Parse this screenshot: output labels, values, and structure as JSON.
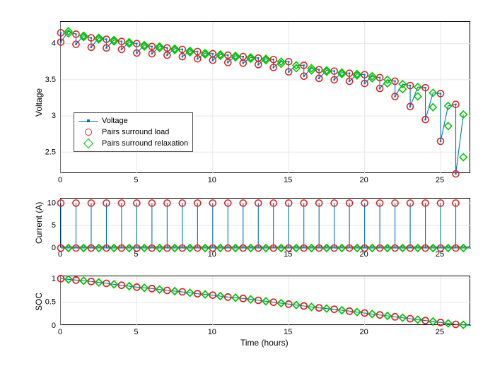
{
  "chart_data": [
    {
      "type": "line",
      "title": "",
      "xlabel": "",
      "ylabel": "Voltage",
      "xlim": [
        0,
        27
      ],
      "ylim": [
        2.2,
        4.3
      ],
      "xticks": [
        0,
        5,
        10,
        15,
        20,
        25
      ],
      "yticks": [
        2.5,
        3,
        3.5,
        4
      ],
      "legend": {
        "entries": [
          "Voltage",
          "Pairs surround load",
          "Pairs surround relaxation"
        ],
        "position": "lower-left-inset"
      },
      "series_voltage_pairs": [
        [
          0,
          4.15,
          4.02
        ],
        [
          1,
          4.13,
          3.99
        ],
        [
          2,
          4.08,
          3.95
        ],
        [
          3,
          4.06,
          3.94
        ],
        [
          4,
          4.03,
          3.92
        ],
        [
          5,
          4.0,
          3.87
        ],
        [
          6,
          3.96,
          3.86
        ],
        [
          7,
          3.94,
          3.84
        ],
        [
          8,
          3.92,
          3.82
        ],
        [
          9,
          3.89,
          3.79
        ],
        [
          10,
          3.86,
          3.77
        ],
        [
          11,
          3.84,
          3.74
        ],
        [
          12,
          3.82,
          3.73
        ],
        [
          13,
          3.8,
          3.71
        ],
        [
          14,
          3.78,
          3.67
        ],
        [
          15,
          3.75,
          3.61
        ],
        [
          16,
          3.7,
          3.55
        ],
        [
          17,
          3.64,
          3.52
        ],
        [
          18,
          3.62,
          3.5
        ],
        [
          19,
          3.59,
          3.48
        ],
        [
          20,
          3.57,
          3.45
        ],
        [
          21,
          3.53,
          3.38
        ],
        [
          22,
          3.48,
          3.27
        ],
        [
          23,
          3.42,
          3.13
        ],
        [
          24,
          3.39,
          2.95
        ],
        [
          25,
          3.31,
          2.65
        ],
        [
          26,
          3.16,
          2.2
        ]
      ],
      "green_pairs": [
        [
          0.5,
          4.17,
          4.14
        ],
        [
          1.5,
          4.11,
          4.09
        ],
        [
          2.5,
          4.08,
          4.06
        ],
        [
          3.5,
          4.05,
          4.03
        ],
        [
          4.5,
          4.02,
          4.0
        ],
        [
          5.5,
          3.98,
          3.96
        ],
        [
          6.5,
          3.96,
          3.94
        ],
        [
          7.5,
          3.93,
          3.91
        ],
        [
          8.5,
          3.9,
          3.88
        ],
        [
          9.5,
          3.87,
          3.85
        ],
        [
          10.5,
          3.85,
          3.83
        ],
        [
          11.5,
          3.83,
          3.81
        ],
        [
          12.5,
          3.81,
          3.79
        ],
        [
          13.5,
          3.79,
          3.77
        ],
        [
          14.5,
          3.75,
          3.72
        ],
        [
          15.5,
          3.7,
          3.66
        ],
        [
          16.5,
          3.66,
          3.63
        ],
        [
          17.5,
          3.63,
          3.61
        ],
        [
          18.5,
          3.6,
          3.58
        ],
        [
          19.5,
          3.58,
          3.56
        ],
        [
          20.5,
          3.55,
          3.52
        ],
        [
          21.5,
          3.5,
          3.45
        ],
        [
          22.5,
          3.44,
          3.37
        ],
        [
          23.5,
          3.4,
          3.27
        ],
        [
          24.5,
          3.32,
          3.12
        ],
        [
          25.5,
          3.14,
          2.86
        ],
        [
          26.5,
          3.02,
          2.43
        ]
      ]
    },
    {
      "type": "stem",
      "title": "",
      "xlabel": "",
      "ylabel": "Current (A)",
      "xlim": [
        0,
        27
      ],
      "ylim": [
        0,
        11
      ],
      "xticks": [
        0,
        5,
        10,
        15,
        20,
        25
      ],
      "yticks": [
        0,
        5,
        10
      ],
      "red_points_y": 10,
      "green_points_y": 0,
      "x_red": [
        0,
        1,
        2,
        3,
        4,
        5,
        6,
        7,
        8,
        9,
        10,
        11,
        12,
        13,
        14,
        15,
        16,
        17,
        18,
        19,
        20,
        21,
        22,
        23,
        24,
        25,
        26
      ],
      "x_green": [
        0.5,
        1.5,
        2.5,
        3.5,
        4.5,
        5.5,
        6.5,
        7.5,
        8.5,
        9.5,
        10.5,
        11.5,
        12.5,
        13.5,
        14.5,
        15.5,
        16.5,
        17.5,
        18.5,
        19.5,
        20.5,
        21.5,
        22.5,
        23.5,
        24.5,
        25.5,
        26.5
      ]
    },
    {
      "type": "line",
      "title": "",
      "xlabel": "Time (hours)",
      "ylabel": "SOC",
      "xlim": [
        0,
        27
      ],
      "ylim": [
        0,
        1.05
      ],
      "xticks": [
        0,
        5,
        10,
        15,
        20,
        25
      ],
      "yticks": [
        0,
        0.5,
        1
      ],
      "soc": [
        [
          0,
          1.0
        ],
        [
          1,
          0.97
        ],
        [
          2,
          0.94
        ],
        [
          3,
          0.9
        ],
        [
          4,
          0.86
        ],
        [
          5,
          0.82
        ],
        [
          6,
          0.79
        ],
        [
          7,
          0.75
        ],
        [
          8,
          0.72
        ],
        [
          9,
          0.68
        ],
        [
          10,
          0.65
        ],
        [
          11,
          0.61
        ],
        [
          12,
          0.58
        ],
        [
          13,
          0.54
        ],
        [
          14,
          0.5
        ],
        [
          15,
          0.46
        ],
        [
          16,
          0.42
        ],
        [
          17,
          0.38
        ],
        [
          18,
          0.35
        ],
        [
          19,
          0.31
        ],
        [
          20,
          0.27
        ],
        [
          21,
          0.23
        ],
        [
          22,
          0.19
        ],
        [
          23,
          0.15
        ],
        [
          24,
          0.11
        ],
        [
          25,
          0.07
        ],
        [
          26,
          0.03
        ],
        [
          27,
          0.01
        ]
      ]
    }
  ],
  "labels": {
    "ylabel1": "Voltage",
    "ylabel2": "Current (A)",
    "ylabel3": "SOC",
    "xlabel": "Time (hours)",
    "legend1": "Voltage",
    "legend2": "Pairs surround load",
    "legend3": "Pairs surround relaxation"
  },
  "colors": {
    "blue": "#0072BD",
    "red": "#d62728",
    "green": "#00c800",
    "grid": "#e6e6e6"
  }
}
